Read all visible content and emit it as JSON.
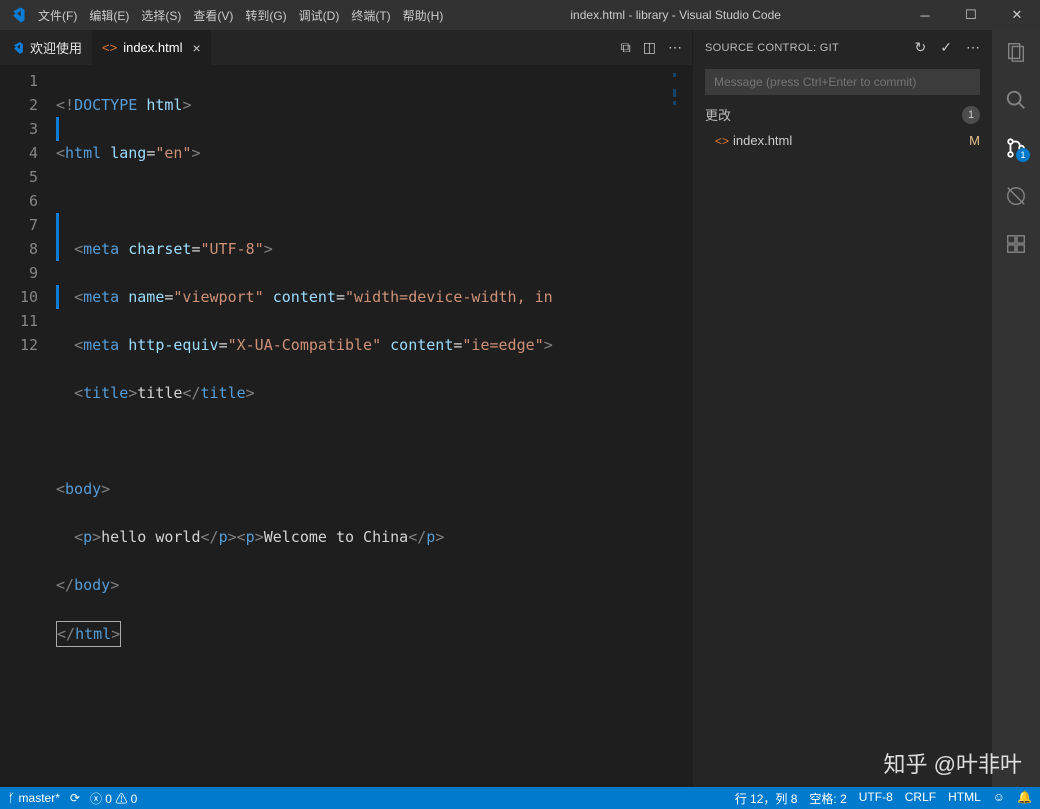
{
  "titlebar": {
    "menus": [
      "文件(F)",
      "编辑(E)",
      "选择(S)",
      "查看(V)",
      "转到(G)",
      "调试(D)",
      "终端(T)",
      "帮助(H)"
    ],
    "title": "index.html - library - Visual Studio Code"
  },
  "tabs": {
    "welcome": "欢迎使用",
    "active": "index.html"
  },
  "code": {
    "lines": 12
  },
  "scm": {
    "title": "SOURCE CONTROL: GIT",
    "message_placeholder": "Message (press Ctrl+Enter to commit)",
    "section": "更改",
    "section_count": "1",
    "item": {
      "name": "index.html",
      "letter": "M"
    }
  },
  "activity": {
    "scm_badge": "1"
  },
  "status": {
    "branch": "master*",
    "errors": "0",
    "warnings": "0",
    "cursor": "行 12，列 8",
    "spaces": "空格: 2",
    "encoding": "UTF-8",
    "eol": "CRLF",
    "lang": "HTML"
  },
  "watermark": "知乎 @叶非叶"
}
